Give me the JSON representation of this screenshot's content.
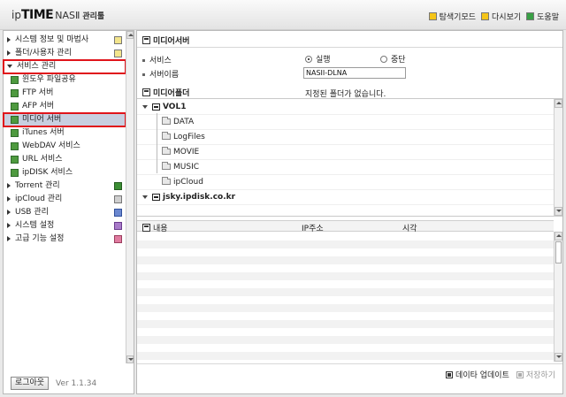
{
  "header": {
    "logo": {
      "ip": "ip",
      "time": "TIME",
      "nas": "NASⅡ",
      "admin": "관리툴"
    },
    "links": [
      {
        "label": "탐색기모드",
        "icon": "explorer-icon"
      },
      {
        "label": "다시보기",
        "icon": "refresh-icon"
      },
      {
        "label": "도움말",
        "icon": "help-icon"
      }
    ]
  },
  "sidebar": {
    "items": [
      {
        "label": "시스템 정보 및 마법사",
        "icon": "chart-icon"
      },
      {
        "label": "폴더/사용자 관리",
        "icon": "user-folder-icon"
      },
      {
        "label": "서비스 관리"
      },
      {
        "label": "윈도우 파일공유",
        "icon": "windows-share-icon"
      },
      {
        "label": "FTP 서버",
        "icon": "ftp-icon"
      },
      {
        "label": "AFP 서버",
        "icon": "afp-icon"
      },
      {
        "label": "미디어 서버",
        "icon": "media-server-icon"
      },
      {
        "label": "iTunes 서버",
        "icon": "itunes-icon"
      },
      {
        "label": "WebDAV 서비스",
        "icon": "webdav-icon"
      },
      {
        "label": "URL 서비스",
        "icon": "url-icon"
      },
      {
        "label": "ipDISK 서비스",
        "icon": "ipdisk-icon"
      },
      {
        "label": "Torrent 관리",
        "icon": "torrent-icon"
      },
      {
        "label": "ipCloud 관리",
        "icon": "ipcloud-icon"
      },
      {
        "label": "USB 관리",
        "icon": "usb-icon"
      },
      {
        "label": "시스템 설정",
        "icon": "system-settings-icon"
      },
      {
        "label": "고급 기능 설정",
        "icon": "advanced-settings-icon"
      }
    ],
    "logout_label": "로그아웃",
    "version": "Ver 1.1.34"
  },
  "main": {
    "title": "미디어서버",
    "service_label": "서비스",
    "radio_run": "실행",
    "radio_stop": "중단",
    "server_name_label": "서버이름",
    "server_name_value": "NASII-DLNA",
    "media_folder_title": "미디어폴더",
    "no_folder_msg": "지정된 폴더가 없습니다.",
    "tree": {
      "vol": "VOL1",
      "folders": [
        "DATA",
        "LogFiles",
        "MOVIE",
        "MUSIC",
        "ipCloud"
      ],
      "remote": "jsky.ipdisk.co.kr"
    },
    "log_columns": {
      "content": "내용",
      "ip": "IP주소",
      "time": "시각"
    },
    "actions": {
      "update": "데이타 업데이트",
      "save": "저장하기"
    }
  }
}
